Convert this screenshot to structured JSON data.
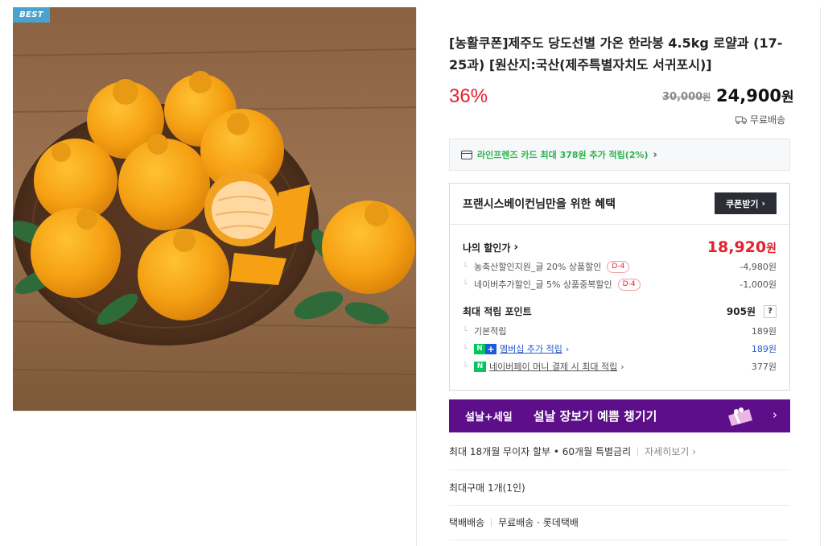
{
  "product": {
    "badge": "BEST",
    "title": "[농활쿠폰]제주도 당도선별 가온 한라봉 4.5kg 로얄과 (17-25과) [원산지:국산(제주특별자치도 서귀포시)]",
    "discount_rate": "36%",
    "original_price": "30,000",
    "original_price_unit": "원",
    "sale_price": "24,900",
    "sale_price_unit": "원",
    "shipping": "무료배송"
  },
  "card_promo": {
    "text": "라인프렌즈 카드 최대 378원 추가 적립(2%)",
    "arrow": "›"
  },
  "benefit": {
    "heading": "프랜시스베이컨님만을 위한 혜택",
    "coupon_button": "쿠폰받기",
    "coupon_arrow": "›",
    "my_price_label": "나의 할인가",
    "my_price_arrow": "›",
    "my_price_value": "18,920",
    "my_price_unit": "원",
    "discounts": [
      {
        "label": "농축산할인지원_글 20% 상품할인",
        "badge": "D-4",
        "amount": "-4,980원"
      },
      {
        "label": "네이버추가할인_글 5% 상품중복할인",
        "badge": "D-4",
        "amount": "-1,000원"
      }
    ],
    "points_label": "최대 적립 포인트",
    "points_value": "905원",
    "points_help": "?",
    "points": [
      {
        "label": "기본적립",
        "amount": "189원"
      },
      {
        "label": "멤버십 추가 적립",
        "arrow": "›",
        "amount": "189원"
      },
      {
        "label": "네이버페이 머니 결제 시 최대 적립",
        "arrow": "›",
        "amount": "377원"
      }
    ],
    "naver_n": "N",
    "naver_plus": "+"
  },
  "banner": {
    "tag": "설날+세일",
    "text": "설날 장보기 예쁨 챙기기",
    "arrow": "›"
  },
  "info_lines": {
    "installment": "최대 18개월 무이자 할부 • 60개월 특별금리",
    "installment_link": "자세히보기 ›",
    "max_purchase": "최대구매 1개(1인)",
    "delivery_label": "택배배송",
    "delivery_value": "무료배송 · 롯데택배"
  },
  "colors": {
    "discount_red": "#e3212f",
    "naver_green": "#03c75a",
    "banner_purple": "#5d0f8a",
    "badge_blue": "#4aa3ce"
  }
}
